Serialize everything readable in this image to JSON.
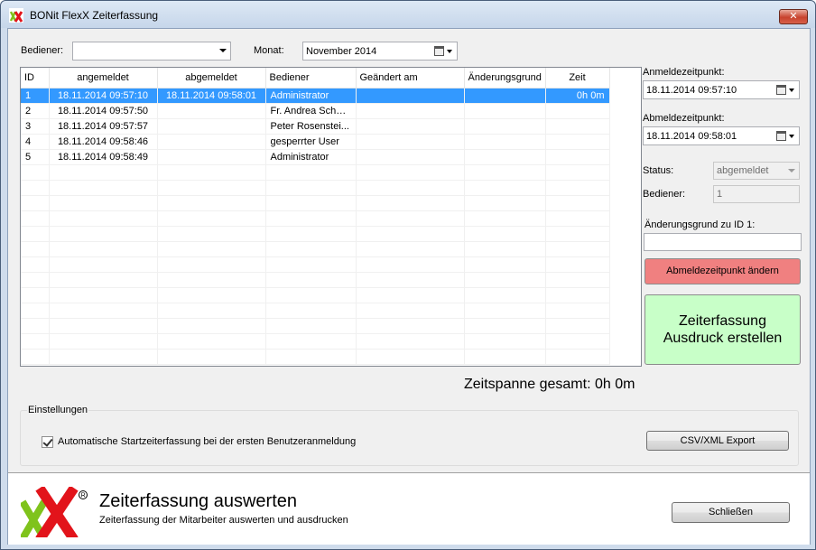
{
  "window": {
    "title": "BONit FlexX Zeiterfassung",
    "close_label": "✕"
  },
  "filter": {
    "operator_label": "Bediener:",
    "operator_value": "",
    "month_label": "Monat:",
    "month_value": "November 2014"
  },
  "table": {
    "columns": [
      "ID",
      "angemeldet",
      "abgemeldet",
      "Bediener",
      "Geändert am",
      "Änderungsgrund",
      "Zeit"
    ],
    "rows": [
      {
        "id": "1",
        "login": "18.11.2014 09:57:10",
        "logout": "18.11.2014 09:58:01",
        "operator": "Administrator",
        "changed": "",
        "reason": "",
        "time": "0h 0m"
      },
      {
        "id": "2",
        "login": "18.11.2014 09:57:50",
        "logout": "",
        "operator": "Fr. Andrea Schw...",
        "changed": "",
        "reason": "",
        "time": ""
      },
      {
        "id": "3",
        "login": "18.11.2014 09:57:57",
        "logout": "",
        "operator": "Peter Rosenstei...",
        "changed": "",
        "reason": "",
        "time": ""
      },
      {
        "id": "4",
        "login": "18.11.2014 09:58:46",
        "logout": "",
        "operator": "gesperrter User",
        "changed": "",
        "reason": "",
        "time": ""
      },
      {
        "id": "5",
        "login": "18.11.2014 09:58:49",
        "logout": "",
        "operator": "Administrator",
        "changed": "",
        "reason": "",
        "time": ""
      }
    ]
  },
  "details": {
    "login_label": "Anmeldezeitpunkt:",
    "login_value": "18.11.2014 09:57:10",
    "logout_label": "Abmeldezeitpunkt:",
    "logout_value": "18.11.2014 09:58:01",
    "status_label": "Status:",
    "status_value": "abgemeldet",
    "operator_label": "Bediener:",
    "operator_value": "1",
    "reason_label": "Änderungsgrund zu ID 1:",
    "reason_value": "",
    "change_button": "Abmeldezeitpunkt ändern",
    "print_button_line1": "Zeiterfassung",
    "print_button_line2": "Ausdruck erstellen"
  },
  "total": "Zeitspanne gesamt: 0h 0m",
  "settings": {
    "title": "Einstellungen",
    "auto_start_label": "Automatische Startzeiterfassung bei der ersten Benutzeranmeldung",
    "auto_start_checked": true,
    "export_button": "CSV/XML Export"
  },
  "footer": {
    "title": "Zeiterfassung auswerten",
    "subtitle": "Zeiterfassung der Mitarbeiter auswerten und ausdrucken",
    "close_button": "Schließen"
  },
  "colors": {
    "selection": "#3399ff",
    "change_button": "#f08080",
    "print_button": "#c8ffc8",
    "logo_green": "#7fc31c",
    "logo_red": "#e2141b"
  }
}
